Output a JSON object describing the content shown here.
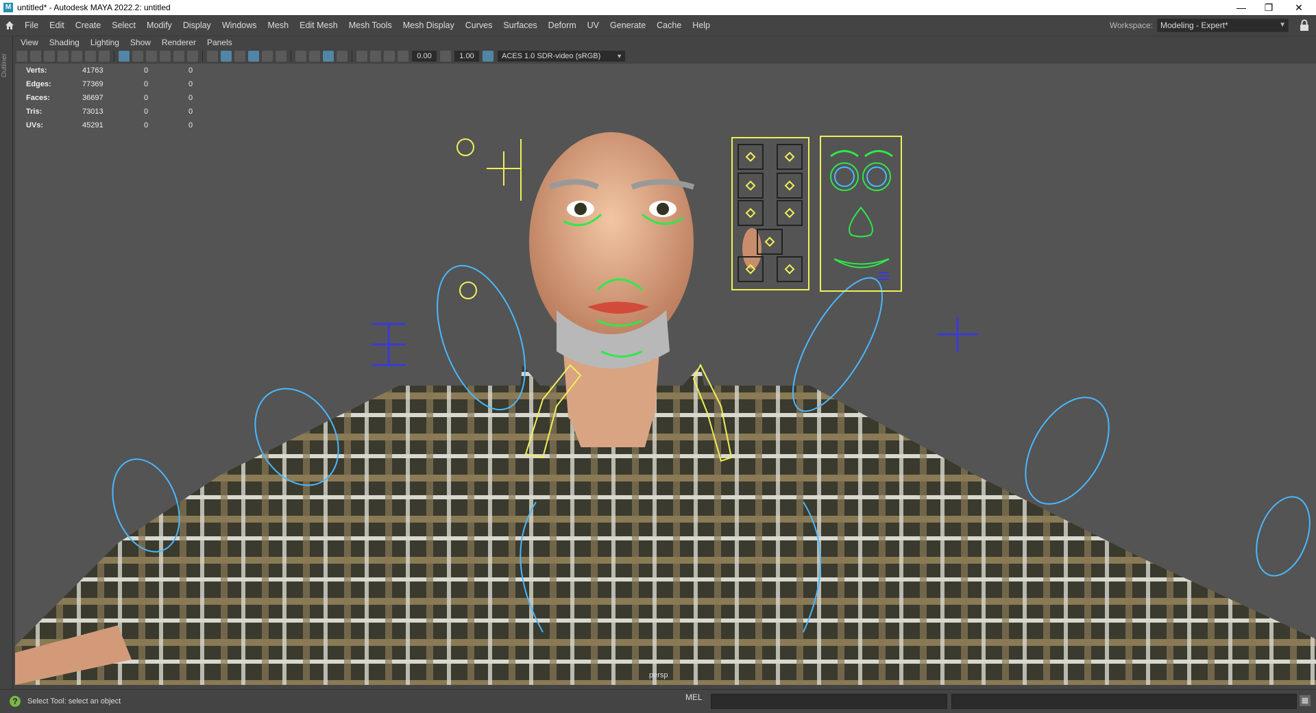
{
  "window": {
    "title": "untitled* - Autodesk MAYA 2022.2: untitled",
    "app_icon": "M",
    "controls": [
      "minimize-icon",
      "restore-icon",
      "close-icon"
    ]
  },
  "menubar": {
    "items": [
      "File",
      "Edit",
      "Create",
      "Select",
      "Modify",
      "Display",
      "Windows",
      "Mesh",
      "Edit Mesh",
      "Mesh Tools",
      "Mesh Display",
      "Curves",
      "Surfaces",
      "Deform",
      "UV",
      "Generate",
      "Cache",
      "Help"
    ],
    "workspace_label": "Workspace:",
    "workspace_value": "Modeling - Expert*"
  },
  "outliner": {
    "label": "Outliner"
  },
  "panel_menu": [
    "View",
    "Shading",
    "Lighting",
    "Show",
    "Renderer",
    "Panels"
  ],
  "toolbar": {
    "near_value": "0.00",
    "gamma_value": "1.00",
    "color_space": "ACES 1.0 SDR-video (sRGB)"
  },
  "hud": [
    {
      "label": "Verts:",
      "value": "41763",
      "sel": "0",
      "comp": "0"
    },
    {
      "label": "Edges:",
      "value": "77369",
      "sel": "0",
      "comp": "0"
    },
    {
      "label": "Faces:",
      "value": "36697",
      "sel": "0",
      "comp": "0"
    },
    {
      "label": "Tris:",
      "value": "73013",
      "sel": "0",
      "comp": "0"
    },
    {
      "label": "UVs:",
      "value": "45291",
      "sel": "0",
      "comp": "0"
    }
  ],
  "camera_label": "persp",
  "status": {
    "help_icon": "?",
    "text": "Select Tool: select an object",
    "mel_label": "MEL"
  },
  "colors": {
    "ctrl_yellow": "#f0f05a",
    "ctrl_cyan": "#4ab8ff",
    "ctrl_green": "#2fe84a",
    "ctrl_blue": "#3a3ad8",
    "viewport_bg": "#545454"
  }
}
